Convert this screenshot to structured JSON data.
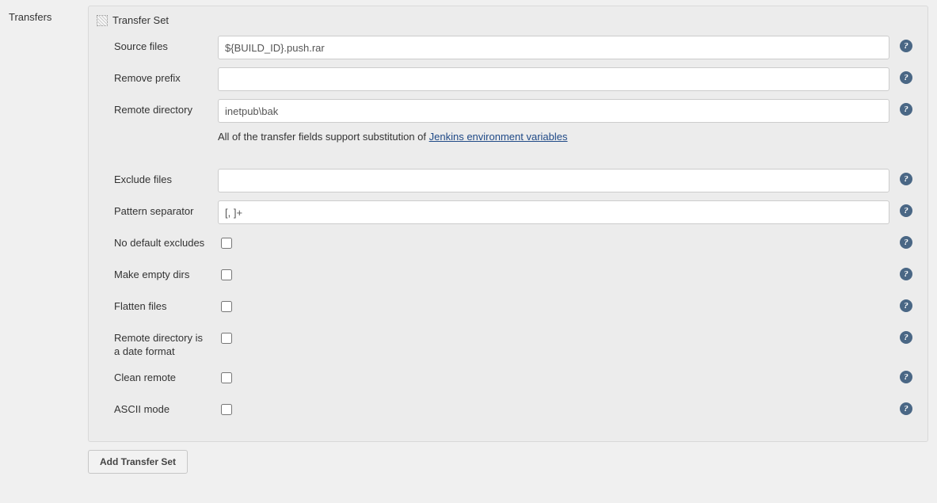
{
  "sectionLabel": "Transfers",
  "transferSet": {
    "header": "Transfer Set",
    "fields": {
      "sourceFiles": {
        "label": "Source files",
        "value": "${BUILD_ID}.push.rar"
      },
      "removePrefix": {
        "label": "Remove prefix",
        "value": ""
      },
      "remoteDirectory": {
        "label": "Remote directory",
        "value": "inetpub\\bak"
      },
      "excludeFiles": {
        "label": "Exclude files",
        "value": ""
      },
      "patternSeparator": {
        "label": "Pattern separator",
        "value": "[, ]+"
      },
      "noDefaultExcludes": {
        "label": "No default excludes",
        "checked": false
      },
      "makeEmptyDirs": {
        "label": "Make empty dirs",
        "checked": false
      },
      "flattenFiles": {
        "label": "Flatten files",
        "checked": false
      },
      "remoteDirIsDate": {
        "label": "Remote directory is a date format",
        "checked": false
      },
      "cleanRemote": {
        "label": "Clean remote",
        "checked": false
      },
      "asciiMode": {
        "label": "ASCII mode",
        "checked": false
      }
    },
    "noteBefore": "All of the transfer fields support substitution of ",
    "noteLink": "Jenkins environment variables"
  },
  "addButton": "Add Transfer Set"
}
